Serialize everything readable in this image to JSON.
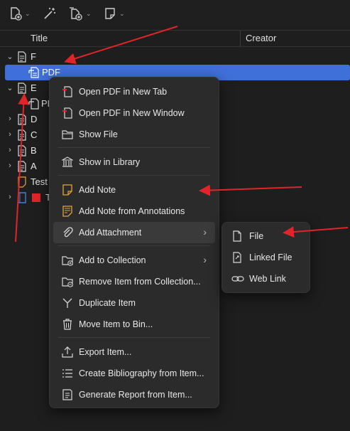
{
  "toolbar": {
    "buttons": [
      {
        "name": "new-item",
        "icon": "new-item-icon"
      },
      {
        "name": "add-by-identifier",
        "icon": "magic-wand-icon"
      },
      {
        "name": "add-attachment",
        "icon": "attachment-add-icon"
      },
      {
        "name": "new-note",
        "icon": "note-add-icon"
      }
    ]
  },
  "columns": {
    "title": "Title",
    "creator": "Creator"
  },
  "tree": {
    "rows": [
      {
        "label": "F"
      },
      {
        "label": "PDF"
      },
      {
        "label": "E"
      },
      {
        "label": "PD"
      },
      {
        "label": "D"
      },
      {
        "label": "C"
      },
      {
        "label": "B"
      },
      {
        "label": "A"
      },
      {
        "label": "Test"
      },
      {
        "label": "T"
      }
    ]
  },
  "context_menu": {
    "items": [
      {
        "label": "Open PDF in New Tab",
        "icon": "pdf-icon"
      },
      {
        "label": "Open PDF in New Window",
        "icon": "pdf-icon"
      },
      {
        "label": "Show File",
        "icon": "folder-icon"
      },
      {
        "label": "Show in Library",
        "icon": "library-icon"
      },
      {
        "label": "Add Note",
        "icon": "note-icon"
      },
      {
        "label": "Add Note from Annotations",
        "icon": "note-annotations-icon"
      },
      {
        "label": "Add Attachment",
        "icon": "paperclip-icon"
      },
      {
        "label": "Add to Collection",
        "icon": "folder-add-icon"
      },
      {
        "label": "Remove Item from Collection...",
        "icon": "folder-remove-icon"
      },
      {
        "label": "Duplicate Item",
        "icon": "duplicate-icon"
      },
      {
        "label": "Move Item to Bin...",
        "icon": "trash-icon"
      },
      {
        "label": "Export Item...",
        "icon": "export-icon"
      },
      {
        "label": "Create Bibliography from Item...",
        "icon": "bibliography-icon"
      },
      {
        "label": "Generate Report from Item...",
        "icon": "report-icon"
      }
    ]
  },
  "submenu": {
    "items": [
      {
        "label": "File",
        "icon": "file-icon"
      },
      {
        "label": "Linked File",
        "icon": "linked-file-icon"
      },
      {
        "label": "Web Link",
        "icon": "web-link-icon"
      }
    ]
  },
  "colors": {
    "background": "#1e1e1e",
    "selection": "#3f6fd8",
    "menu_background": "#2b2b2b",
    "annotation_arrow": "#e0242a",
    "accent_orange": "#e3a53a",
    "pdf_red": "#e0242a"
  }
}
